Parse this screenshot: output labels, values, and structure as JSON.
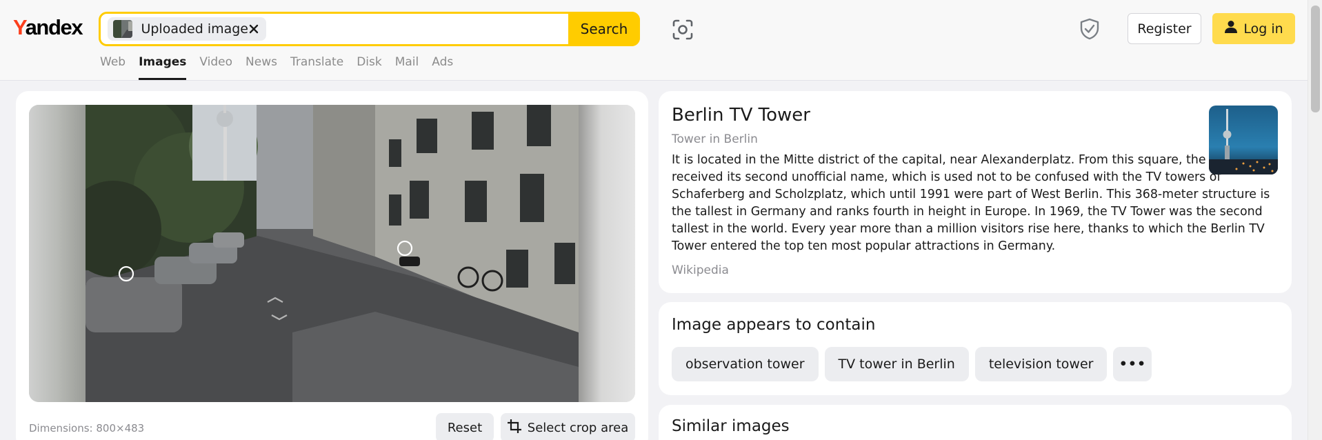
{
  "header": {
    "logo": {
      "first_letter": "Y",
      "rest": "andex"
    },
    "search": {
      "chip_label": "Uploaded image",
      "chip_close_icon": "close-icon",
      "button_label": "Search"
    },
    "lens_icon": "camera-lens-icon",
    "nav": [
      {
        "label": "Web",
        "active": false
      },
      {
        "label": "Images",
        "active": true
      },
      {
        "label": "Video",
        "active": false
      },
      {
        "label": "News",
        "active": false
      },
      {
        "label": "Translate",
        "active": false
      },
      {
        "label": "Disk",
        "active": false
      },
      {
        "label": "Mail",
        "active": false
      },
      {
        "label": "Ads",
        "active": false
      }
    ],
    "shield_icon": "shield-check-icon",
    "register_label": "Register",
    "login_label": "Log in",
    "login_icon": "user-icon"
  },
  "viewer": {
    "dimensions_label": "Dimensions: 800×483",
    "reset_label": "Reset",
    "crop_label": "Select crop area",
    "crop_icon": "crop-icon"
  },
  "info": {
    "title": "Berlin TV Tower",
    "subtitle": "Tower in Berlin",
    "text": "It is located in the Mitte district of the capital, near Alexanderplatz. From this square, the tower received its second unofficial name, which is used not to be confused with the TV towers of Schaferberg and Scholzplatz, which until 1991 were part of West Berlin. This 368-meter structure is the tallest in Germany and ranks fourth in height in Europe. In 1969, the TV Tower was the second tallest in the world. Every year more than a million visitors rise here, thanks to which the Berlin TV Tower entered the top ten most popular attractions in Germany.",
    "source": "Wikipedia"
  },
  "contains": {
    "title": "Image appears to contain",
    "tags": [
      "observation tower",
      "TV tower in Berlin",
      "television tower"
    ],
    "more_label": "•••"
  },
  "similar": {
    "title": "Similar images"
  },
  "colors": {
    "accent_yellow": "#ffcc00",
    "login_yellow": "#ffdb4d",
    "logo_red": "#fc3f1d"
  }
}
